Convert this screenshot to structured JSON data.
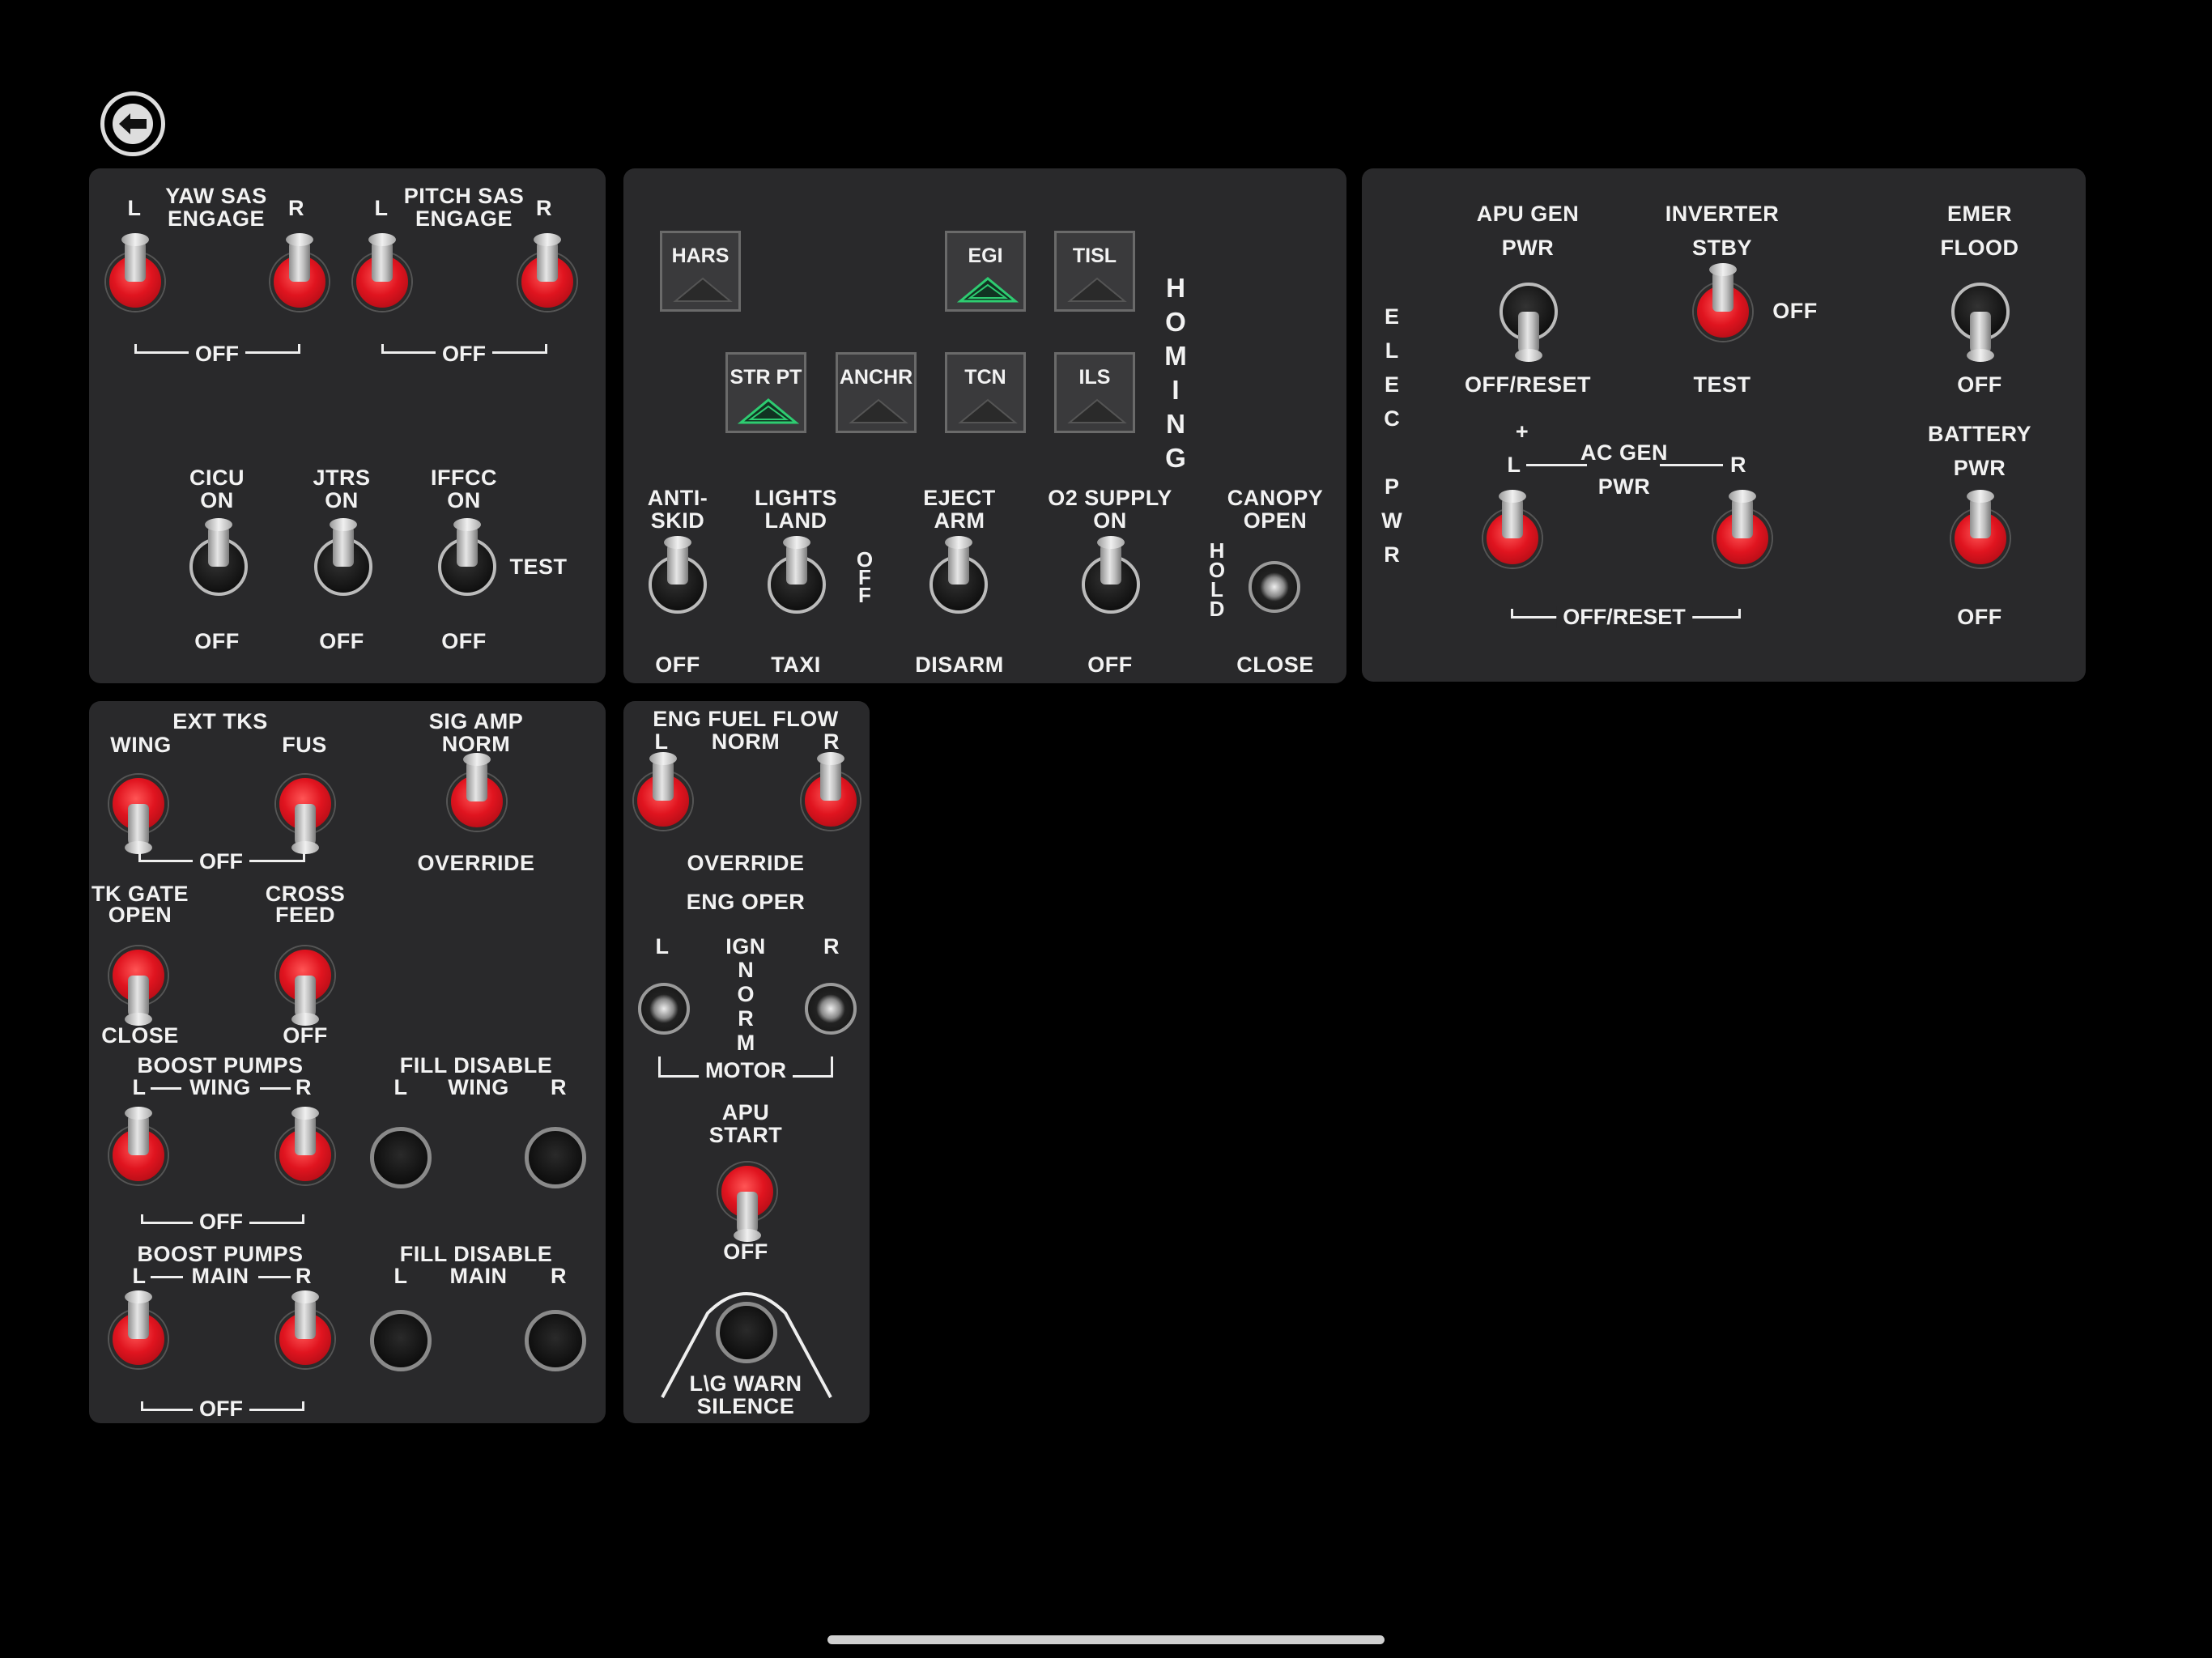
{
  "nav": {
    "back_icon": "back-arrow-icon"
  },
  "sas": {
    "yaw_label": "YAW SAS\nENGAGE",
    "pitch_label": "PITCH SAS\nENGAGE",
    "l": "L",
    "r": "R",
    "off": "OFF",
    "cicu": "CICU\nON",
    "jtrs": "JTRS\nON",
    "iffcc": "IFFCC\nON",
    "test": "TEST"
  },
  "nav_keys": [
    "HARS",
    "EGI",
    "TISL",
    "STR PT",
    "ANCHR",
    "TCN",
    "ILS"
  ],
  "nav_keys_active": [
    "EGI",
    "STR PT"
  ],
  "homing": "H\nO\nM\nI\nN\nG",
  "misc": {
    "antiskid": "ANTI-\nSKID",
    "antiskid_off": "OFF",
    "lights": "LIGHTS\nLAND",
    "lights_off": "O\nF\nF",
    "taxi": "TAXI",
    "eject": "EJECT\nARM",
    "disarm": "DISARM",
    "o2": "O2 SUPPLY\nON",
    "o2_off": "OFF",
    "canopy": "CANOPY\nOPEN",
    "hold": "H\nO\nL\nD",
    "close": "CLOSE"
  },
  "elec": {
    "side": "E\nL\nE\nC\n\nP\nW\nR",
    "apu_gen": "APU GEN\nPWR",
    "apu_off": "OFF/RESET",
    "inverter": "INVERTER\nSTBY",
    "inv_off": "OFF",
    "inv_test": "TEST",
    "emer": "EMER\nFLOOD",
    "emer_off": "OFF",
    "plus": "+",
    "l": "L",
    "r": "R",
    "ac_gen": "AC GEN\nPWR",
    "ac_off": "OFF/RESET",
    "battery": "BATTERY\nPWR",
    "battery_off": "OFF"
  },
  "fuel": {
    "ext_tks": "EXT TKS",
    "wing": "WING",
    "fus": "FUS",
    "ext_off": "OFF",
    "sig_amp": "SIG AMP\nNORM",
    "override": "OVERRIDE",
    "tk_gate": "TK GATE\nOPEN",
    "tk_close": "CLOSE",
    "cross_feed": "CROSS\nFEED",
    "cross_off": "OFF",
    "boost_wing": "BOOST PUMPS",
    "boost_wing_sub": "WING",
    "boost_wing_off": "OFF",
    "fill_wing": "FILL DISABLE",
    "fill_wing_sub": "WING",
    "boost_main": "BOOST PUMPS",
    "boost_main_sub": "MAIN",
    "boost_main_off": "OFF",
    "fill_main": "FILL DISABLE",
    "fill_main_sub": "MAIN",
    "l": "L",
    "r": "R"
  },
  "engine": {
    "fuel_flow": "ENG FUEL FLOW",
    "norm": "NORM",
    "l": "L",
    "r": "R",
    "override": "OVERRIDE",
    "eng_oper": "ENG OPER",
    "ign": "IGN",
    "norm_v": "N\nO\nR\nM",
    "motor": "MOTOR",
    "apu_start": "APU\nSTART",
    "apu_off": "OFF",
    "lg_warn": "L\\G WARN\nSILENCE"
  },
  "colors": {
    "panel": "#29292b",
    "switch_red": "#e0141f",
    "egi_green": "#2ecc71"
  }
}
